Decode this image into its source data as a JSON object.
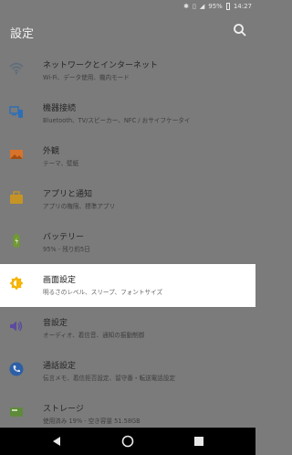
{
  "status": {
    "battery": "95%",
    "time": "14:27"
  },
  "header": {
    "title": "設定"
  },
  "items": [
    {
      "title": "ネットワークとインターネット",
      "subtitle": "Wi-Fi、データ使用、機内モード",
      "icon": "wifi-icon",
      "color": "#5f6d7a"
    },
    {
      "title": "機器接続",
      "subtitle": "Bluetooth、TV/スピーカー、NFC / おサイフケータイ",
      "icon": "devices-icon",
      "color": "#2b6fb8"
    },
    {
      "title": "外観",
      "subtitle": "テーマ、壁紙",
      "icon": "appearance-icon",
      "color": "#d9732b"
    },
    {
      "title": "アプリと通知",
      "subtitle": "アプリの権限、標準アプリ",
      "icon": "apps-icon",
      "color": "#c59424"
    },
    {
      "title": "バッテリー",
      "subtitle": "95% - 残り約5日",
      "icon": "battery-icon",
      "color": "#6f9a31"
    },
    {
      "title": "画面設定",
      "subtitle": "明るさのレベル、スリープ、フォントサイズ",
      "icon": "brightness-icon",
      "color": "#f5b400"
    },
    {
      "title": "音設定",
      "subtitle": "オーディオ、着信音、通知の振動制御",
      "icon": "volume-icon",
      "color": "#5b4aa0"
    },
    {
      "title": "通話設定",
      "subtitle": "伝言メモ、着信拒否設定、留守番・転送電話設定",
      "icon": "phone-icon",
      "color": "#2c5fa6"
    },
    {
      "title": "ストレージ",
      "subtitle": "使用済み 19% - 空き容量 51.58GB",
      "icon": "storage-icon",
      "color": "#5f8a3a"
    }
  ]
}
